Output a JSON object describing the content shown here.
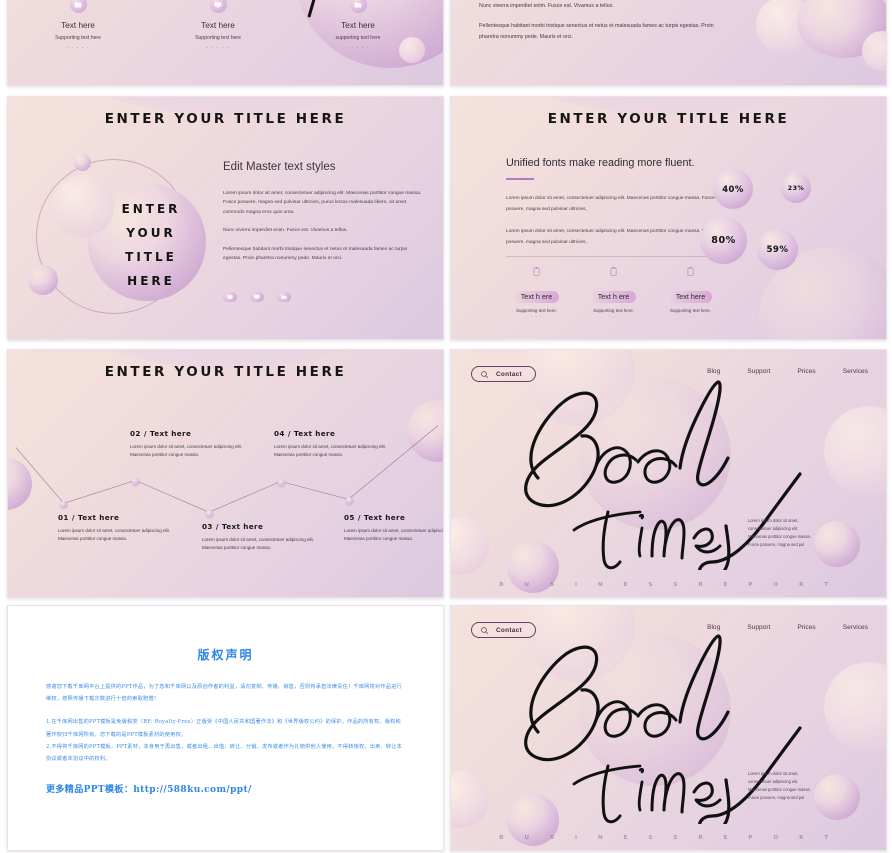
{
  "deck": {
    "theme_colors": {
      "bg_light": "#f6e2dc",
      "bg_mid": "#f0dcdc",
      "bg_accent": "#ddc9e0",
      "orb_purple": "#c79ccd",
      "text_dark": "#151515",
      "link_blue": "#2f86e8",
      "nav_purple": "#4a2a4d"
    },
    "common": {
      "title": "ENTER YOUR TITLE HERE"
    }
  },
  "slide_icon_trio": {
    "items": [
      {
        "icon": "image-icon",
        "title": "Text here",
        "subtitle": "Supporting text here",
        "dashes": "- - - - -"
      },
      {
        "icon": "monitor-icon",
        "title": "Text here",
        "subtitle": "Supporting text here",
        "dashes": "- - - - -"
      },
      {
        "icon": "folder-icon",
        "title": "Text here",
        "subtitle": "supporting text here",
        "dashes": "- - - - -"
      }
    ]
  },
  "slide_paragraphs": {
    "paragraphs": [
      "Nunc viverra imperdiet enim. Fusce est. Vivamus a tellus.",
      "Pellentesque habitant morbi tristique senectus et netus et malesuada fames ac turpis egestas. Proin pharetra nonummy pede. Mauris et orci."
    ]
  },
  "slide_hero": {
    "title": "ENTER YOUR TITLE HERE",
    "hero_lines": [
      "ENTER",
      "YOUR",
      "TITLE",
      "HERE"
    ],
    "heading": "Edit Master text styles",
    "paragraphs": [
      "Lorem ipsum dolor sit amet, consectetuer adipiscing elit. Maecenas porttitor congue massa. Fusce posuere, magna sed pulvinar ultricies, purus lectus malesuada libero, sit amet commodo magna eros quis urna.",
      "Nunc viverra imperdiet enim. Fusce est. Vivamus a tellus.",
      "Pellentesque habitant morbi tristique senectus et netus et malesuada fames ac turpis egestas. Proin pharetra nonummy pede. Mauris et orci."
    ],
    "icons": [
      "image-icon",
      "monitor-icon",
      "folder-icon"
    ]
  },
  "slide_stats": {
    "title": "ENTER YOUR TITLE HERE",
    "heading": "Unified fonts make reading more fluent.",
    "paragraphs": [
      "Lorem ipsum dolor sit amet, consectetuer adipiscing elit. Maecenas porttitor congue massa. Fusce posuere, magna sed pulvinar ultricies,",
      "Lorem ipsum dolor sit amet, consectetuer adipiscing elit. Maecenas porttitor congue massa. Fusce posuere, magna sed pulvinar ultricies,"
    ],
    "cards": [
      {
        "icon": "clipboard-icon",
        "label": "Text h ere",
        "subtitle": "Supporting text here.",
        "dashes": "- - -"
      },
      {
        "icon": "clipboard-icon",
        "label": "Text h ere",
        "subtitle": "Supporting text here.",
        "dashes": "- - -"
      },
      {
        "icon": "clipboard-icon",
        "label": "Text  here",
        "subtitle": "Supporting text here.",
        "dashes": "- - -"
      }
    ],
    "chart_data": {
      "type": "bubble",
      "title": "Unified fonts make reading more fluent.",
      "labels": [
        "40%",
        "23%",
        "80%",
        "59%"
      ],
      "values": [
        40,
        23,
        80,
        59
      ],
      "unit": "%",
      "legend": "none",
      "grid": false
    }
  },
  "slide_zigzag": {
    "title": "ENTER YOUR TITLE HERE",
    "steps": [
      {
        "num": "01",
        "sep": "/",
        "label": "Text here",
        "body": "Lorem ipsum dolor sit amet, consectetuer adipiscing elit. Maecenas porttitor congue massa."
      },
      {
        "num": "02",
        "sep": "/",
        "label": "Text here",
        "body": "Lorem ipsum dolor sit amet, consectetuer adipiscing elit. Maecenas porttitor congue massa."
      },
      {
        "num": "03",
        "sep": "/",
        "label": "Text here",
        "body": "Lorem ipsum dolor sit amet, consectetuer adipiscing elit. Maecenas porttitor congue massa."
      },
      {
        "num": "04",
        "sep": "/",
        "label": "Text here",
        "body": "Lorem ipsum dolor sit amet, consectetuer adipiscing elit. Maecenas porttitor congue massa."
      },
      {
        "num": "05",
        "sep": "/",
        "label": "Text here",
        "body": "Lorem ipsum dolor sit amet, consectetuer adipiscing elit. Maecenas porttitor congue massa."
      }
    ],
    "chart_data": {
      "type": "line",
      "title": "ENTER YOUR TITLE HERE",
      "categories": [
        "01",
        "02",
        "03",
        "04",
        "05"
      ],
      "values": [
        28,
        62,
        18,
        60,
        34
      ],
      "xlabel": "",
      "ylabel": "",
      "grid": false,
      "legend": "none",
      "markers": true
    }
  },
  "slide_copyright": {
    "title": "版权声明",
    "intro": "感谢您下载千库网平台上提供的PPT作品，为了您和千库网以及原创作者的利益，请勿复制、传播、销售，否则将承担法律责任！千库网将对作品进行维权，按照传播下载次数进行十倍的索取赔偿！",
    "terms": [
      "1.在千库网出售的PPT模板是免版税类（RF: Royalty-Free）正版受《中国人民共和国著作法》和《世界版权公约》的保护。作品的所有权、版权和著作权归千库网所有，您下载的是PPT模板素材的使用权。",
      "2.不得将千库网的PPT模板、PPT素材，本身用于再出售，或者出租、出借、转让、分销、发布或者作为礼物供他人使用，不得转授权、出卖、转让本协议或者本协议中的权利。"
    ],
    "link_label": "更多精品PPT模板：",
    "link_url": "http://588ku.com/ppt/"
  },
  "slide_web": {
    "contact_label": "Contact",
    "search_icon": "search-icon",
    "nav": [
      "Blog",
      "Support",
      "Prices",
      "Services"
    ],
    "script_text": "Good Times",
    "body_lines": [
      "Lorem ipsum dolor sit amet,",
      "consectetuer adipiscing elit.",
      "Maecenas porttitor congue massa.",
      "Fusce posuere, magna sed pul"
    ],
    "footer": "B U S I N E S S     R E P O R T"
  }
}
